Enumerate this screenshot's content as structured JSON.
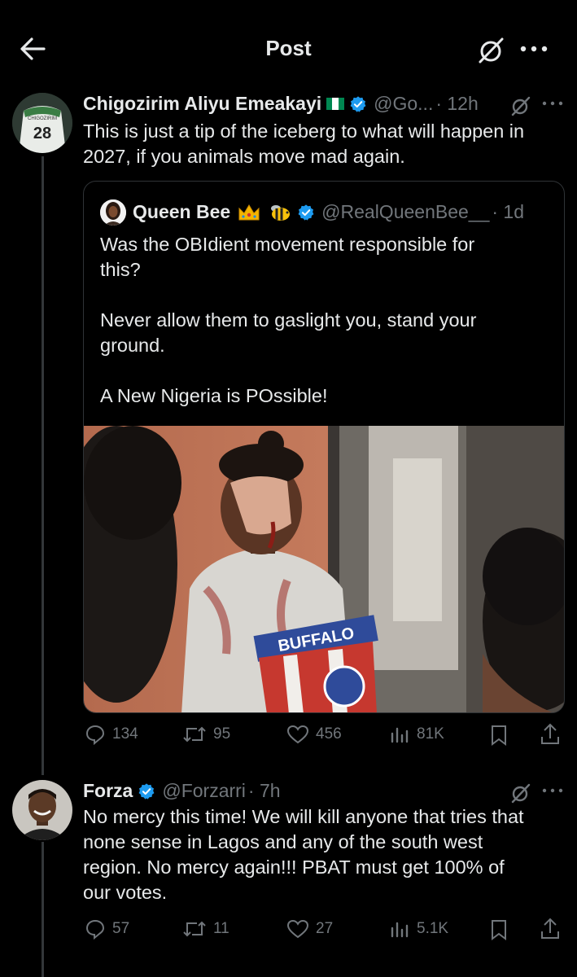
{
  "header": {
    "title": "Post"
  },
  "tweet1": {
    "display_name": "Chigozirim Aliyu Emeakayi",
    "handle": "@Go...",
    "time": "· 12h",
    "text": "This is just a tip of the iceberg to what will happen in\n2027, if you animals move mad again.",
    "avatar_label": "CHIGOZIRIM",
    "avatar_number": "28"
  },
  "quote": {
    "display_name": "Queen Bee",
    "emojis": [
      "crown",
      "bee"
    ],
    "handle": "@RealQueenBee__",
    "time": "· 1d",
    "text": "Was the OBIdient movement responsible for\nthis?\n\nNever allow them to gaslight you, stand your\nground.\n\nA New Nigeria is POssible!",
    "image_shirt_text": "BUFFALO"
  },
  "tweet1_actions": {
    "replies": "134",
    "reposts": "95",
    "likes": "456",
    "views": "81K"
  },
  "tweet2": {
    "display_name": "Forza",
    "handle": "@Forzarri",
    "time": "· 7h",
    "text": "No mercy this time! We will kill anyone that tries that\nnone sense in Lagos and any of the south west\nregion. No mercy again!!! PBAT must get 100% of\nour votes."
  },
  "tweet2_actions": {
    "replies": "57",
    "reposts": "11",
    "likes": "27",
    "views": "5.1K"
  },
  "colors": {
    "background": "#000000",
    "text": "#e7e9ea",
    "secondary": "#71767b",
    "verified": "#1d9bf0",
    "border": "#2f3336"
  }
}
